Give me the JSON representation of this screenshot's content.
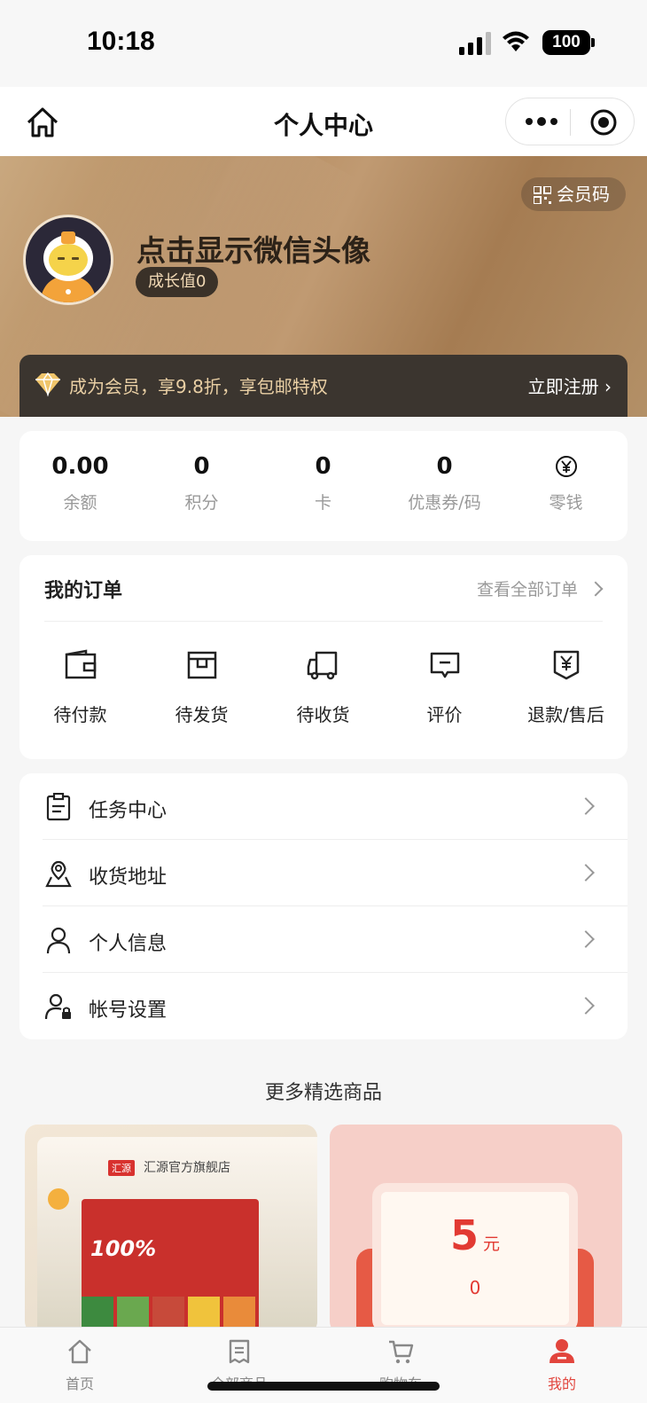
{
  "status": {
    "time": "10:18",
    "battery": "100"
  },
  "navbar": {
    "title": "个人中心"
  },
  "banner": {
    "member_code": "会员码",
    "nickname": "点击显示微信头像",
    "growth": "成长值0",
    "vip_text": "成为会员，享9.8折，享包邮特权",
    "register": "立即注册",
    "colors": {
      "gold": "#b48a5d",
      "vip_bar": "#3b352f",
      "vip_text": "#e9cfa4"
    }
  },
  "assets": [
    {
      "value": "0.00",
      "label": "余额"
    },
    {
      "value": "0",
      "label": "积分"
    },
    {
      "value": "0",
      "label": "卡"
    },
    {
      "value": "0",
      "label": "优惠券/码"
    },
    {
      "icon": "yen-coin-icon",
      "label": "零钱"
    }
  ],
  "orders": {
    "title": "我的订单",
    "view_all": "查看全部订单",
    "items": [
      {
        "label": "待付款",
        "icon": "wallet-icon"
      },
      {
        "label": "待发货",
        "icon": "package-icon"
      },
      {
        "label": "待收货",
        "icon": "truck-icon"
      },
      {
        "label": "评价",
        "icon": "comment-icon"
      },
      {
        "label": "退款/售后",
        "icon": "refund-icon"
      }
    ]
  },
  "menu": [
    {
      "label": "任务中心",
      "icon": "clipboard-icon"
    },
    {
      "label": "收货地址",
      "icon": "map-pin-icon"
    },
    {
      "label": "个人信息",
      "icon": "user-icon"
    },
    {
      "label": "帐号设置",
      "icon": "user-lock-icon"
    }
  ],
  "more": {
    "title": "更多精选商品",
    "left_brand": "汇源官方旗舰店",
    "left_logo": "汇源",
    "left_badge": "100%",
    "coupon_amount": "5",
    "coupon_unit": "元",
    "coupon_count": "0"
  },
  "tabbar": [
    {
      "label": "首页",
      "icon": "home-icon"
    },
    {
      "label": "全部商品",
      "icon": "list-icon"
    },
    {
      "label": "购物车",
      "icon": "cart-icon"
    },
    {
      "label": "我的",
      "icon": "profile-icon",
      "active": true
    }
  ],
  "accent": "#e2453d"
}
